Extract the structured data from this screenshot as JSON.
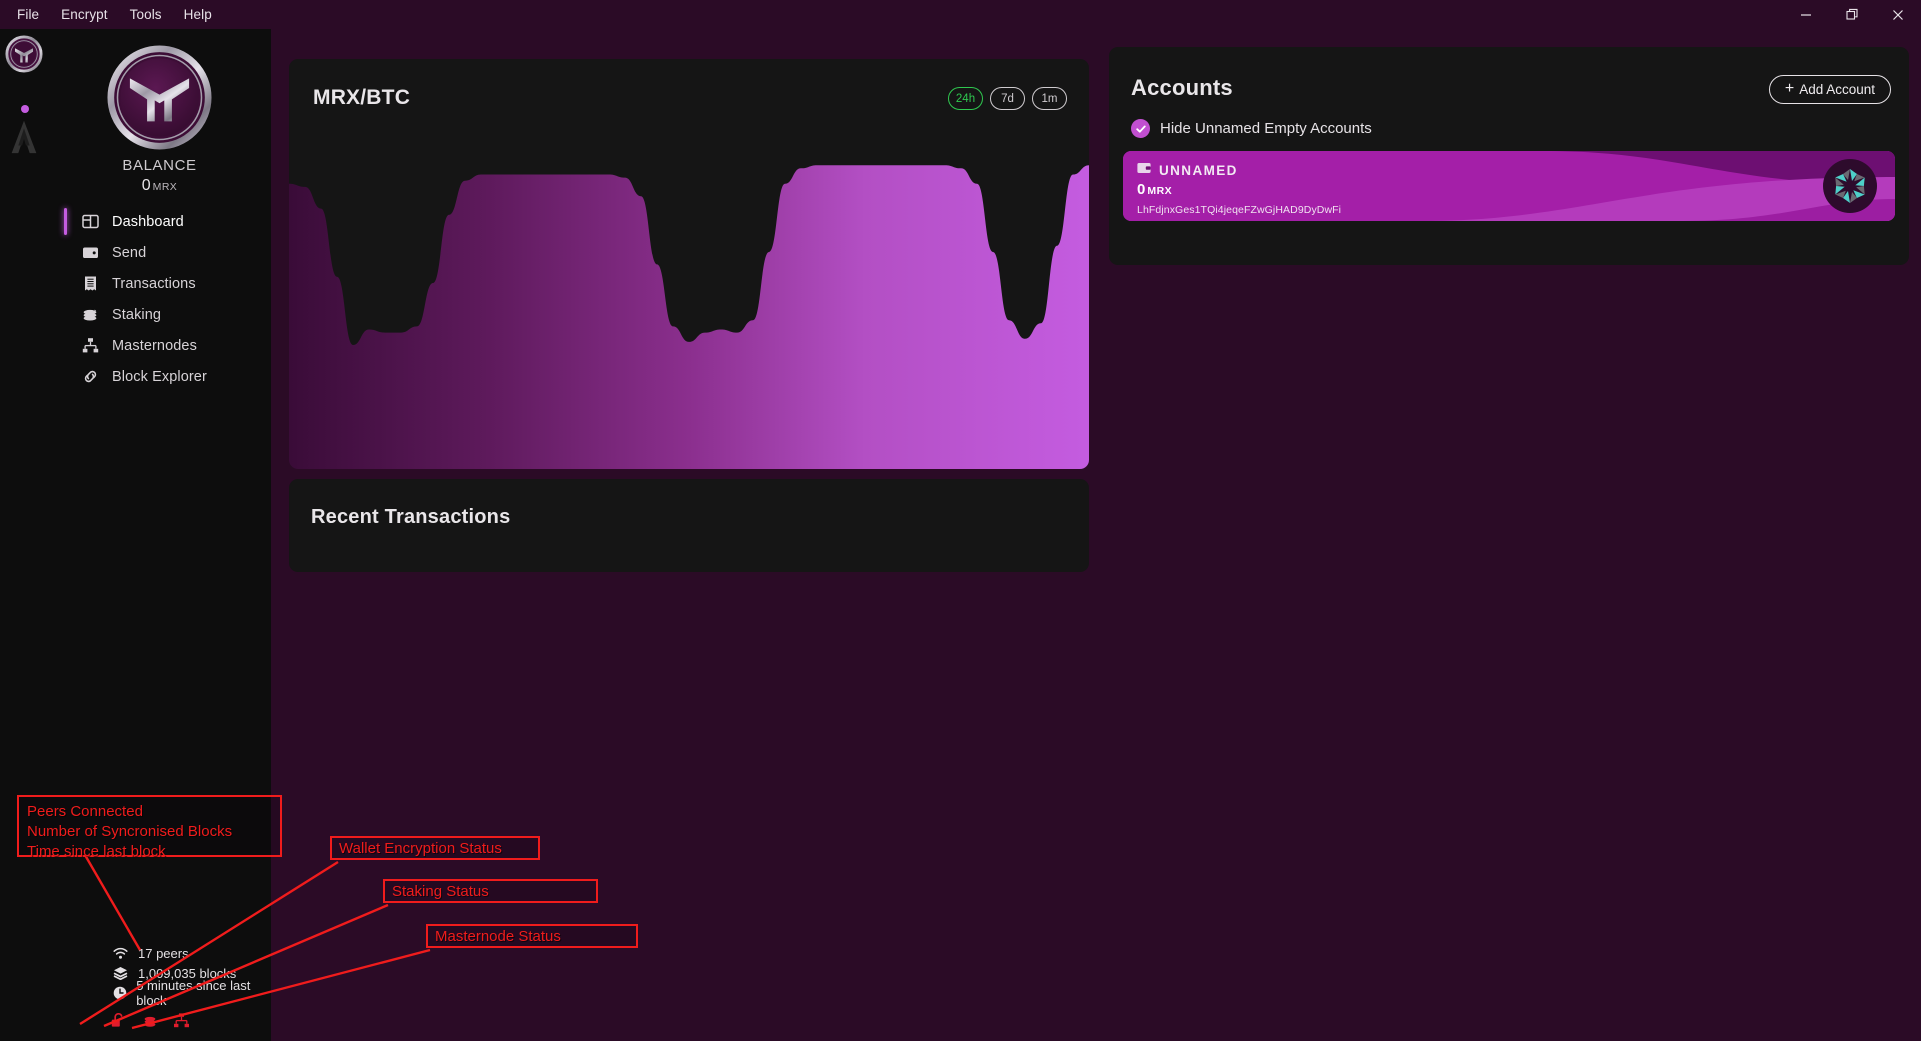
{
  "window": {
    "menu": [
      "File",
      "Encrypt",
      "Tools",
      "Help"
    ],
    "controls": [
      {
        "name": "minimize",
        "glyph": "minimize-icon"
      },
      {
        "name": "restore",
        "glyph": "restore-icon"
      },
      {
        "name": "close",
        "glyph": "close-icon"
      }
    ]
  },
  "rail": {
    "apps": [
      {
        "name": "metrix-wallet-app-icon",
        "active": true
      },
      {
        "name": "secondary-app-icon",
        "active": false
      }
    ]
  },
  "sidebar": {
    "logo_icon": "metrix-logo-icon",
    "balance_label": "BALANCE",
    "balance_value": "0",
    "balance_unit": "MRX",
    "items": [
      {
        "label": "Dashboard",
        "icon": "dashboard-icon",
        "active": true
      },
      {
        "label": "Send",
        "icon": "wallet-send-icon",
        "active": false
      },
      {
        "label": "Transactions",
        "icon": "receipt-icon",
        "active": false
      },
      {
        "label": "Staking",
        "icon": "coins-stack-icon",
        "active": false
      },
      {
        "label": "Masternodes",
        "icon": "network-nodes-icon",
        "active": false
      },
      {
        "label": "Block Explorer",
        "icon": "link-chain-icon",
        "active": false
      }
    ]
  },
  "status_bar": {
    "rows": [
      {
        "icon": "wifi-icon",
        "text": "17 peers"
      },
      {
        "icon": "layers-icon",
        "text": "1,009,035 blocks"
      },
      {
        "icon": "clock-icon",
        "text": "5 minutes since last block"
      }
    ],
    "icons": [
      {
        "name": "unlock-icon",
        "color": "#e01c2c"
      },
      {
        "name": "coins-stack-status-icon",
        "color": "#e01c2c"
      },
      {
        "name": "masternode-status-icon",
        "color": "#e01c2c"
      }
    ]
  },
  "chart_panel": {
    "title": "MRX/BTC",
    "ranges": [
      {
        "label": "24h",
        "active": true
      },
      {
        "label": "7d",
        "active": false
      },
      {
        "label": "1m",
        "active": false
      }
    ]
  },
  "chart_data": {
    "type": "area",
    "title": "MRX/BTC",
    "xlabel": "",
    "ylabel": "",
    "grid": false,
    "legend": false,
    "series": [
      {
        "name": "MRX/BTC",
        "x": [
          0,
          2,
          4,
          6,
          8,
          10,
          12,
          14,
          16,
          18,
          20,
          22,
          24,
          26,
          28,
          30,
          32,
          34,
          36,
          38,
          40,
          42,
          44,
          46,
          48,
          50,
          52,
          54,
          56,
          58,
          60,
          62,
          64,
          66,
          68,
          70,
          72,
          74,
          76,
          78,
          80,
          82,
          84,
          86,
          88,
          90,
          92,
          94,
          96,
          98,
          100
        ],
        "values": [
          92,
          91,
          84,
          62,
          40,
          45,
          44,
          44,
          46,
          60,
          82,
          93,
          95,
          95,
          95,
          95,
          95,
          95,
          95,
          95,
          95,
          94,
          88,
          66,
          46,
          41,
          44,
          45,
          44,
          48,
          70,
          92,
          97,
          98,
          98,
          98,
          98,
          98,
          98,
          98,
          98,
          98,
          97,
          92,
          70,
          48,
          42,
          47,
          72,
          95,
          98
        ]
      }
    ],
    "ylim": [
      0,
      100
    ],
    "xlim": [
      0,
      100
    ],
    "gradient": {
      "from": "#3a0c38",
      "to": "#c45ce0",
      "direction": "horizontal"
    }
  },
  "transactions_panel": {
    "title": "Recent Transactions",
    "rows": []
  },
  "accounts_panel": {
    "title": "Accounts",
    "add_button_label": "Add Account",
    "hide_unnamed_label": "Hide Unnamed Empty Accounts",
    "hide_unnamed_checked": true,
    "accounts": [
      {
        "name": "UNNAMED",
        "balance": "0",
        "unit": "MRX",
        "address": "LhFdjnxGes1TQi4jeqeFZwGjHAD9DyDwFi",
        "identicon": "account-identicon"
      }
    ]
  },
  "annotations": {
    "color": "#f01c1c",
    "items": [
      {
        "lines": [
          "Peers Connected",
          "Number of Syncronised Blocks",
          "Time since last block"
        ]
      },
      {
        "lines": [
          "Wallet Encryption Status"
        ]
      },
      {
        "lines": [
          "Staking Status"
        ]
      },
      {
        "lines": [
          "Masternode Status"
        ]
      }
    ]
  },
  "colors": {
    "background": "#2b0b26",
    "panel": "#151515",
    "sidebar": "#0d0d0d",
    "accent": "#c45ce0",
    "account_card": "#a41fa8",
    "active_range": "#2fc84f",
    "annotation": "#f01c1c"
  }
}
